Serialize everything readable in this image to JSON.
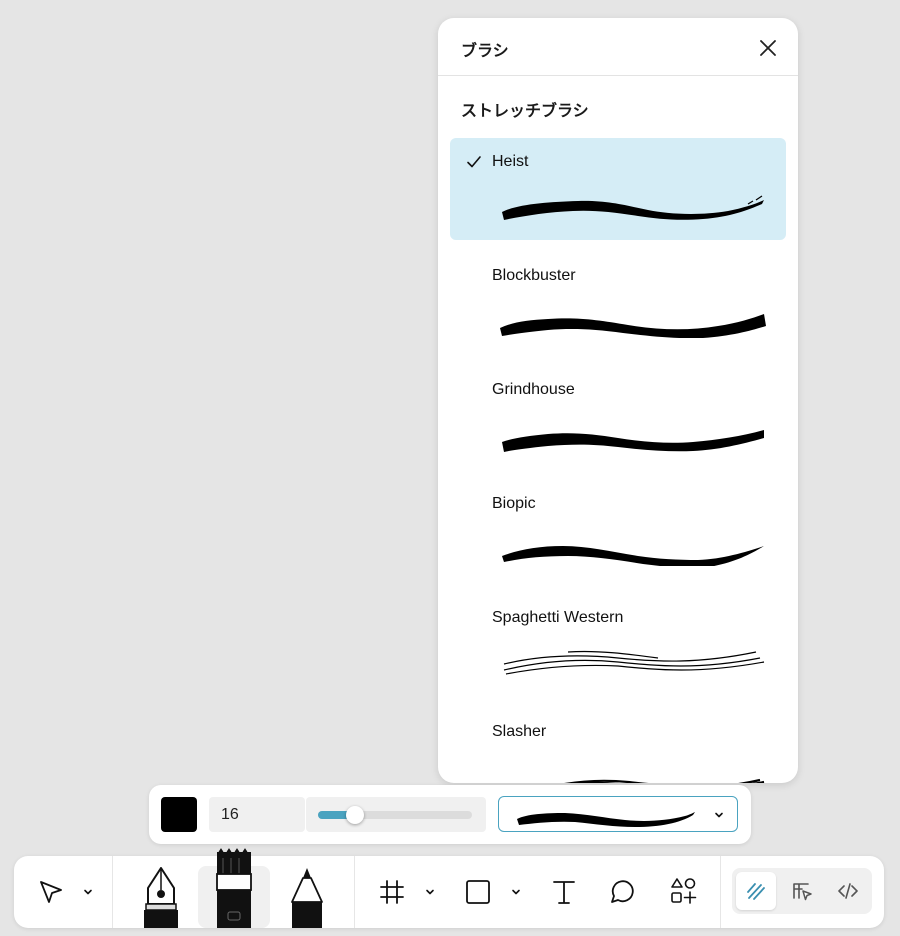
{
  "brush_panel": {
    "title": "ブラシ",
    "section_title": "ストレッチブラシ",
    "brushes": [
      {
        "name": "Heist",
        "selected": true
      },
      {
        "name": "Blockbuster",
        "selected": false
      },
      {
        "name": "Grindhouse",
        "selected": false
      },
      {
        "name": "Biopic",
        "selected": false
      },
      {
        "name": "Spaghetti Western",
        "selected": false
      },
      {
        "name": "Slasher",
        "selected": false
      }
    ]
  },
  "options_bar": {
    "color": "#000000",
    "size": "16",
    "slider_fraction": 0.24,
    "selected_brush": "Heist"
  },
  "toolbar": {
    "tools": [
      "move-icon",
      "pen-icon",
      "brush-icon",
      "pencil-icon",
      "frame-icon",
      "rectangle-icon",
      "text-icon",
      "comment-icon",
      "shapes-icon"
    ],
    "active_mode": "draw"
  },
  "colors": {
    "accent": "#4aa3c0",
    "selected_row": "#d5edf6",
    "background": "#e5e5e5"
  }
}
